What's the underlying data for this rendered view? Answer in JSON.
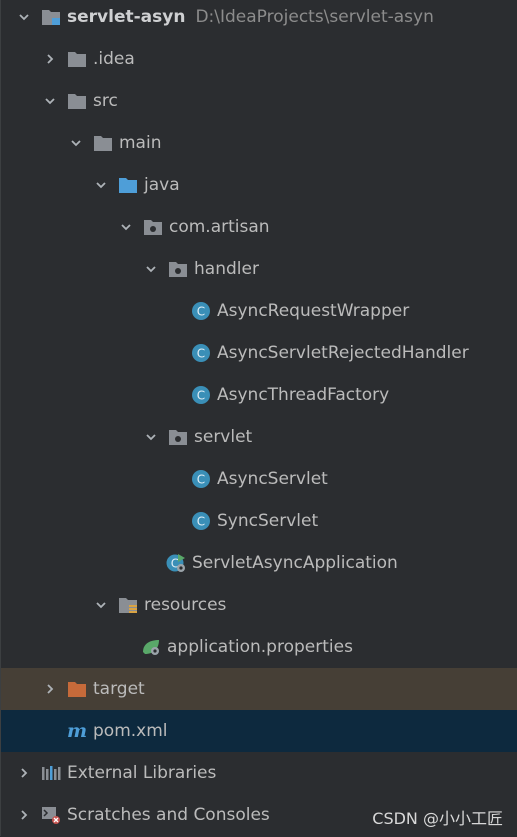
{
  "project": {
    "name": "servlet-asyn",
    "path": "D:\\IdeaProjects\\servlet-asyn"
  },
  "tree": {
    "idea": ".idea",
    "src": "src",
    "main": "main",
    "java": "java",
    "package": "com.artisan",
    "handler": "handler",
    "handler_classes": [
      "AsyncRequestWrapper",
      "AsyncServletRejectedHandler",
      "AsyncThreadFactory"
    ],
    "servlet": "servlet",
    "servlet_classes": [
      "AsyncServlet",
      "SyncServlet"
    ],
    "app_class": "ServletAsyncApplication",
    "resources": "resources",
    "properties": "application.properties",
    "target": "target",
    "pom": "pom.xml",
    "external_libraries": "External Libraries",
    "scratches": "Scratches and Consoles"
  },
  "watermark": "CSDN @小小工匠",
  "colors": {
    "background": "#2b2d30",
    "folder": "#8a8e94",
    "source_folder": "#4e9ed8",
    "excluded_folder": "#c66a3a",
    "class_icon": "#3a8fb7",
    "selected_target_row": "#463f36",
    "selected_pom_row": "#0d293e"
  }
}
